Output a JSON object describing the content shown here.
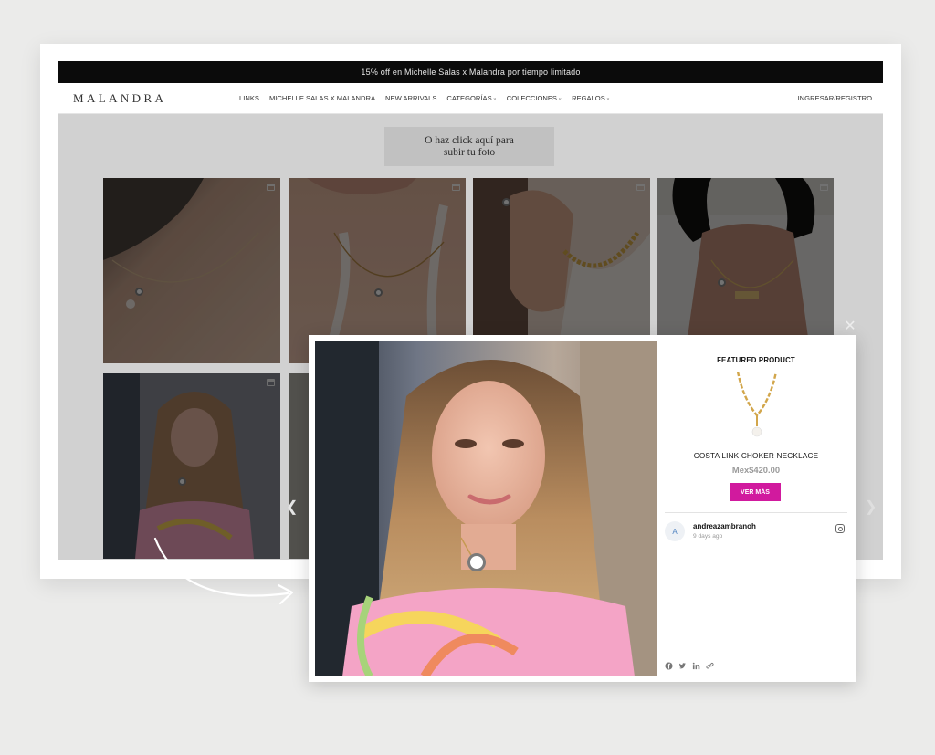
{
  "site": {
    "promo_text": "15% off en Michelle Salas x Malandra por tiempo limitado",
    "brand": "MALANDRA",
    "menu": [
      {
        "label": "LINKS",
        "caret": false
      },
      {
        "label": "MICHELLE SALAS X MALANDRA",
        "caret": false
      },
      {
        "label": "NEW ARRIVALS",
        "caret": false
      },
      {
        "label": "CATEGORÍAS",
        "caret": true
      },
      {
        "label": "COLECCIONES",
        "caret": true
      },
      {
        "label": "REGALOS",
        "caret": true
      }
    ],
    "login": "INGRESAR/REGISTRO",
    "upload_line1": "O haz click aquí para",
    "upload_line2": "subir tu foto"
  },
  "modal": {
    "featured_title": "FEATURED PRODUCT",
    "product_name": "COSTA LINK CHOKER NECKLACE",
    "product_price": "Mex$420.00",
    "cta_label": "VER MÁS",
    "user_initial": "A",
    "username": "andreazambranoh",
    "posted": "9 days ago",
    "icons": {
      "close": "close-icon",
      "prev": "chevron-left-icon",
      "next": "chevron-right-icon",
      "network": "instagram-icon",
      "shares": [
        "facebook-icon",
        "twitter-icon",
        "linkedin-icon",
        "link-icon"
      ]
    }
  },
  "colors": {
    "cta": "#d11a9e",
    "promo_bar": "#0b0b0b",
    "avatar_text": "#4a7fbf"
  }
}
